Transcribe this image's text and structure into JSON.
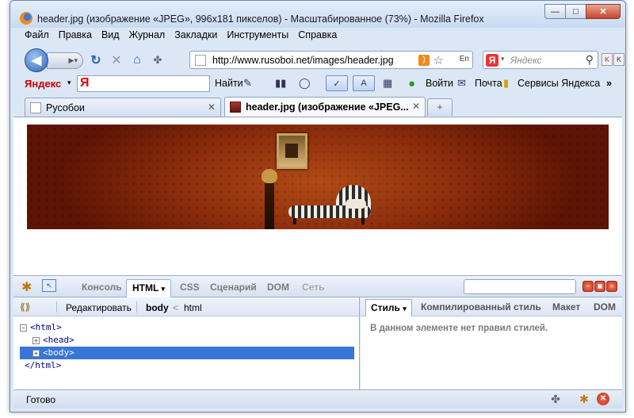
{
  "window": {
    "title": "header.jpg (изображение «JPEG», 996x181 пикселов) - Масштабированное (73%) - Mozilla Firefox",
    "controls": {
      "minimize": "—",
      "maximize": "□",
      "close": "✕"
    }
  },
  "menu": [
    "Файл",
    "Правка",
    "Вид",
    "Журнал",
    "Закладки",
    "Инструменты",
    "Справка"
  ],
  "nav": {
    "url": "http://www.rusoboi.net/images/header.jpg",
    "search_placeholder": "Яндекс",
    "translate_badge": "En"
  },
  "yandex_bar": {
    "logo": "Яндекс",
    "input_logo": "Я",
    "find": "Найти",
    "login": "Войти",
    "mail": "Почта",
    "services": "Сервисы Яндекса",
    "more": "»"
  },
  "tabs": [
    {
      "title": "Русобои",
      "active": false
    },
    {
      "title": "header.jpg (изображение «JPEG...",
      "active": true
    }
  ],
  "firebug": {
    "panels": [
      "Консоль",
      "HTML",
      "CSS",
      "Сценарий",
      "DOM",
      "Сеть"
    ],
    "active_panel": "HTML",
    "html_toolbar": {
      "edit": "Редактировать",
      "crumb_body": "body",
      "crumb_sep": "<",
      "crumb_html": "html"
    },
    "tree": [
      {
        "toggle": "−",
        "text": "<html>",
        "indent": 0,
        "selected": false
      },
      {
        "toggle": "+",
        "text": "<head>",
        "indent": 1,
        "selected": false
      },
      {
        "toggle": "+",
        "text": "<body>",
        "indent": 1,
        "selected": true
      },
      {
        "toggle": "",
        "text": "</html>",
        "indent": 0,
        "selected": false
      }
    ],
    "side_tabs": [
      "Стиль",
      "Компилированный стиль",
      "Макет",
      "DOM"
    ],
    "active_side_tab": "Стиль",
    "side_message": "В данном элементе нет правил стилей."
  },
  "status": {
    "text": "Готово"
  },
  "colors": {
    "accent": "#3875d7",
    "window_frame": "#6d8bb0",
    "banner": "#8f2f0d"
  }
}
